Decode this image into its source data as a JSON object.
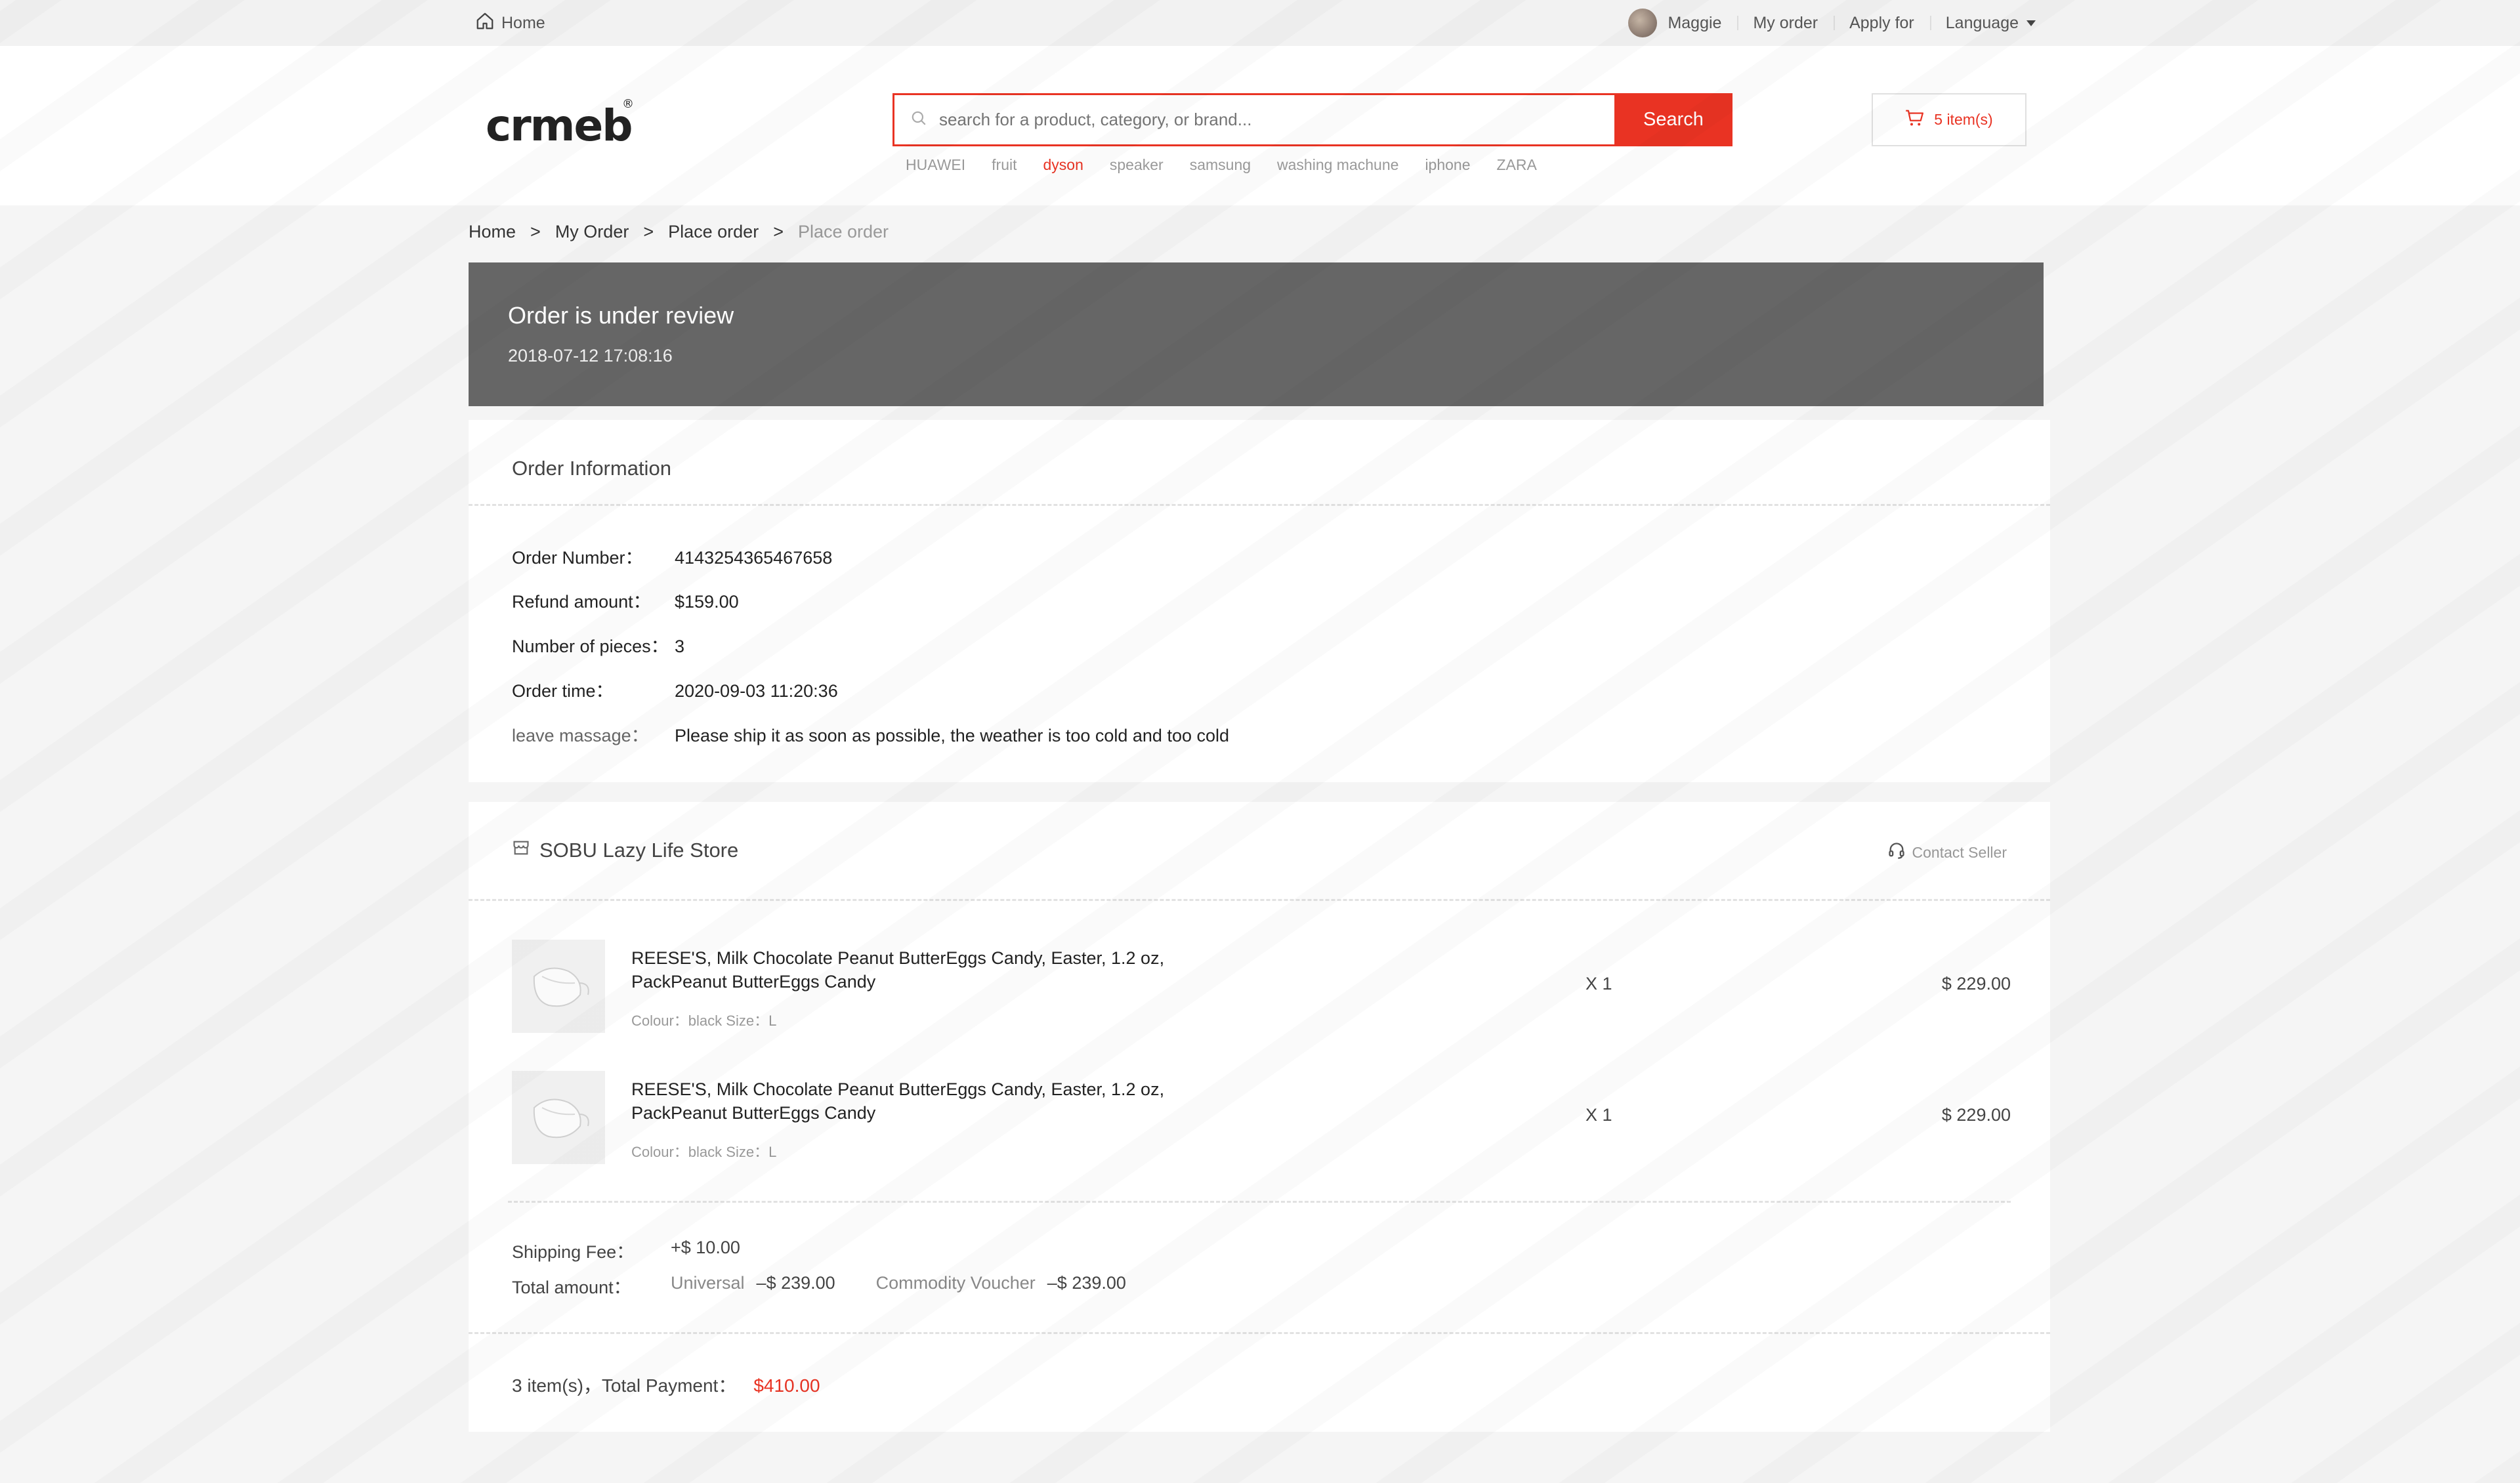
{
  "topbar": {
    "home_label": "Home",
    "user_name": "Maggie",
    "my_order_label": "My order",
    "apply_label": "Apply for",
    "language_label": "Language"
  },
  "header": {
    "logo_text": "crmeb",
    "search_placeholder": "search for a product, category, or brand...",
    "search_button": "Search",
    "hot_keywords": [
      "HUAWEI",
      "fruit",
      "dyson",
      "speaker",
      "samsung",
      "washing machune",
      "iphone",
      "ZARA"
    ],
    "cart_label": "5 item(s)",
    "accent_color": "#e93323"
  },
  "breadcrumb": [
    "Home",
    "My Order",
    "Place order",
    "Place order"
  ],
  "status": {
    "title": "Order is under review",
    "datetime": "2018-07-12  17:08:16"
  },
  "order_info": {
    "title": "Order Information",
    "rows": [
      {
        "label": "Order Number：",
        "value": "4143254365467658"
      },
      {
        "label": "Refund amount：",
        "value": "$159.00"
      },
      {
        "label": "Number of pieces：",
        "value": "3"
      },
      {
        "label": "Order time：",
        "value": "2020-09-03 11:20:36"
      },
      {
        "label": "leave massage：",
        "value": "Please ship it as soon as possible, the weather is too cold and too cold"
      }
    ]
  },
  "store": {
    "name": "SOBU Lazy Life Store",
    "contact_label": "Contact Seller",
    "items": [
      {
        "name": "REESE'S, Milk Chocolate Peanut ButterEggs Candy, Easter, 1.2 oz, PackPeanut ButterEggs Candy",
        "attrs": "Colour：black   Size：L",
        "qty": "X 1",
        "price": "$ 229.00"
      },
      {
        "name": "REESE'S, Milk Chocolate Peanut ButterEggs Candy, Easter, 1.2 oz, PackPeanut ButterEggs Candy",
        "attrs": "Colour：black   Size：L",
        "qty": "X 1",
        "price": "$ 229.00"
      }
    ],
    "shipping_label": "Shipping Fee：",
    "shipping_value": "+$ 10.00",
    "total_label": "Total amount：",
    "universal_label": "Universal",
    "universal_value": "–$ 239.00",
    "voucher_label": "Commodity Voucher",
    "voucher_value": "–$ 239.00",
    "summary_label": "3 item(s)，Total Payment：",
    "summary_value": "$410.00"
  }
}
